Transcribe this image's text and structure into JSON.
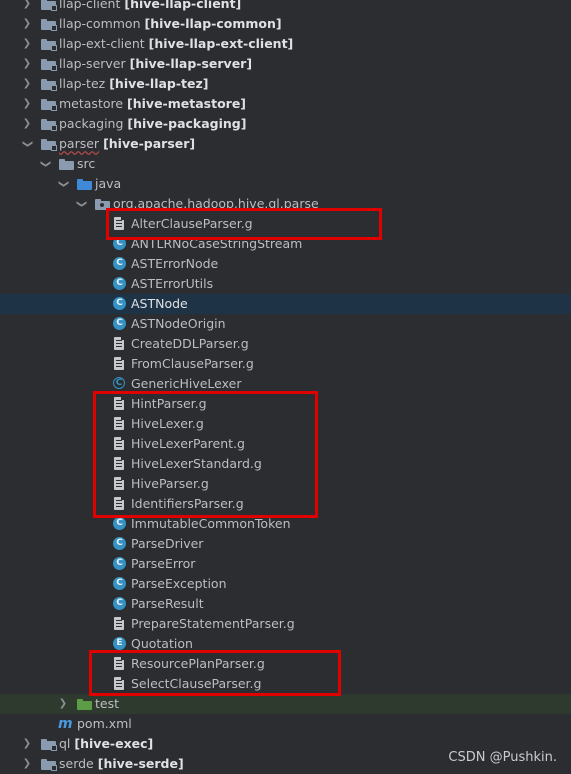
{
  "tree": {
    "rows": [
      {
        "name": "llap-client",
        "module": "[hive-llap-client]"
      },
      {
        "name": "llap-common",
        "module": "[hive-llap-common]"
      },
      {
        "name": "llap-ext-client",
        "module": "[hive-llap-ext-client]"
      },
      {
        "name": "llap-server",
        "module": "[hive-llap-server]"
      },
      {
        "name": "llap-tez",
        "module": "[hive-llap-tez]"
      },
      {
        "name": "metastore",
        "module": "[hive-metastore]"
      },
      {
        "name": "packaging",
        "module": "[hive-packaging]"
      },
      {
        "name": "parser",
        "module": "[hive-parser]"
      },
      {
        "name": "src"
      },
      {
        "name": "java"
      },
      {
        "name": "org.apache.hadoop.hive.ql.parse"
      },
      {
        "name": "AlterClauseParser.g"
      },
      {
        "name": "ANTLRNoCaseStringStream"
      },
      {
        "name": "ASTErrorNode"
      },
      {
        "name": "ASTErrorUtils"
      },
      {
        "name": "ASTNode"
      },
      {
        "name": "ASTNodeOrigin"
      },
      {
        "name": "CreateDDLParser.g"
      },
      {
        "name": "FromClauseParser.g"
      },
      {
        "name": "GenericHiveLexer"
      },
      {
        "name": "HintParser.g"
      },
      {
        "name": "HiveLexer.g"
      },
      {
        "name": "HiveLexerParent.g"
      },
      {
        "name": "HiveLexerStandard.g"
      },
      {
        "name": "HiveParser.g"
      },
      {
        "name": "IdentifiersParser.g"
      },
      {
        "name": "ImmutableCommonToken"
      },
      {
        "name": "ParseDriver"
      },
      {
        "name": "ParseError"
      },
      {
        "name": "ParseException"
      },
      {
        "name": "ParseResult"
      },
      {
        "name": "PrepareStatementParser.g"
      },
      {
        "name": "Quotation"
      },
      {
        "name": "ResourcePlanParser.g"
      },
      {
        "name": "SelectClauseParser.g"
      },
      {
        "name": "test"
      },
      {
        "name": "pom.xml"
      },
      {
        "name": "ql",
        "module": "[hive-exec]"
      },
      {
        "name": "serde",
        "module": "[hive-serde]"
      }
    ]
  },
  "icons": {
    "m": "m",
    "c": "C",
    "e": "E"
  },
  "colors": {
    "highlight_box": "#e00000",
    "selection": "#1f3346",
    "class_icon": "#3592c4"
  },
  "watermark": "CSDN @Pushkin."
}
